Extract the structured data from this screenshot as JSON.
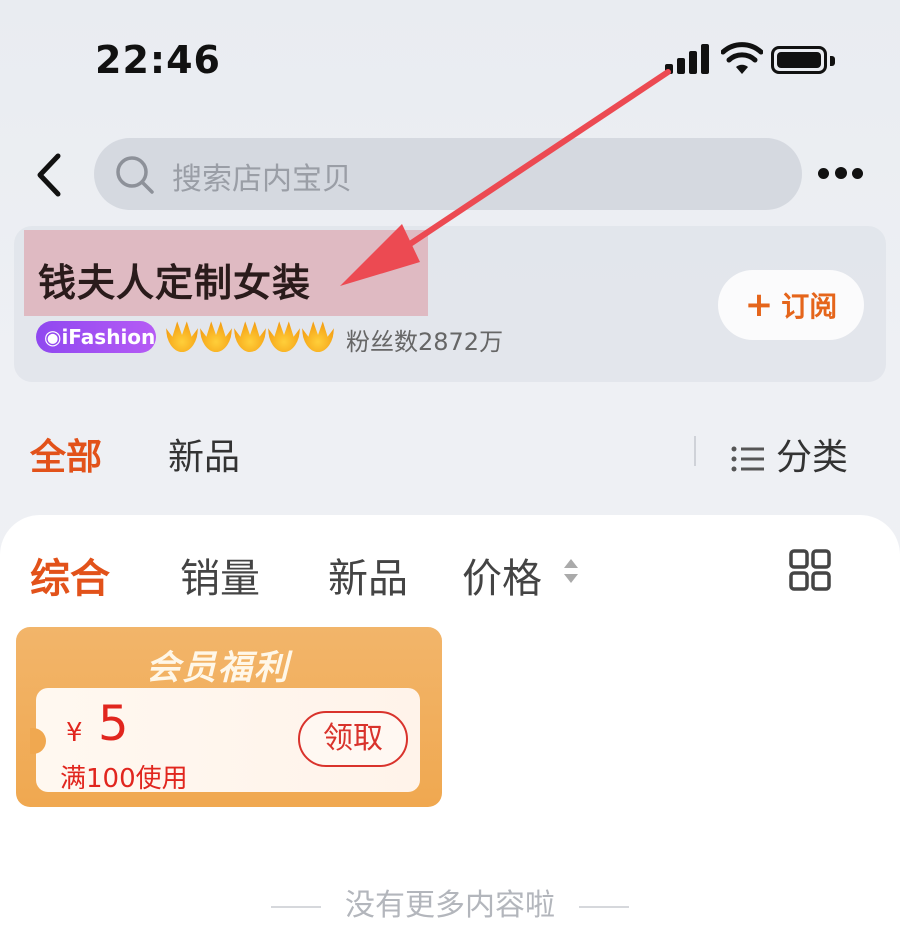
{
  "status_bar": {
    "time": "22:46"
  },
  "nav": {
    "back_icon": "chevron-left-icon",
    "search_placeholder": "搜索店内宝贝",
    "more_icon": "more-dots-icon"
  },
  "shop": {
    "name": "钱夫人定制女装",
    "badge": "iFashion",
    "crown_count": 5,
    "fans": "粉丝数2872万",
    "subscribe_plus": "+",
    "subscribe_label": "订阅"
  },
  "top_tabs": {
    "all": "全部",
    "new": "新品",
    "category": "分类"
  },
  "sort_tabs": [
    {
      "label": "综合",
      "active": true
    },
    {
      "label": "销量",
      "active": false
    },
    {
      "label": "新品",
      "active": false
    },
    {
      "label": "价格",
      "active": false
    }
  ],
  "coupon": {
    "title": "会员福利",
    "currency": "¥",
    "amount": "5",
    "condition": "满100使用",
    "claim_label": "领取"
  },
  "footer": {
    "no_more": "没有更多内容啦"
  },
  "colors": {
    "accent": "#e2521a",
    "coupon_red": "#e1261e",
    "badge_purple": "#9a4ff2",
    "annotation_red": "#ec4a52"
  }
}
